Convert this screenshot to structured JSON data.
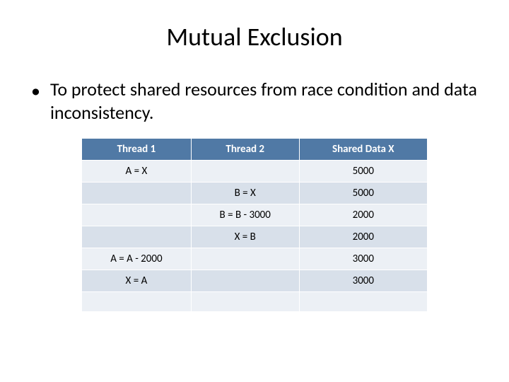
{
  "title": "Mutual Exclusion",
  "bullet_text": "To protect shared resources from race condition and data inconsistency.",
  "headers": {
    "c0": "Thread 1",
    "c1": "Thread 2",
    "c2": "Shared Data X"
  },
  "rows": [
    {
      "c0": "A = X",
      "c1": "",
      "c2": "5000"
    },
    {
      "c0": "",
      "c1": "B = X",
      "c2": "5000"
    },
    {
      "c0": "",
      "c1": "B = B - 3000",
      "c2": "2000"
    },
    {
      "c0": "",
      "c1": "X = B",
      "c2": "2000"
    },
    {
      "c0": "A = A - 2000",
      "c1": "",
      "c2": "3000"
    },
    {
      "c0": "X = A",
      "c1": "",
      "c2": "3000"
    },
    {
      "c0": "",
      "c1": "",
      "c2": ""
    }
  ],
  "chart_data": {
    "type": "table",
    "columns": [
      "Thread 1",
      "Thread 2",
      "Shared Data X"
    ],
    "rows": [
      [
        "A = X",
        "",
        5000
      ],
      [
        "",
        "B = X",
        5000
      ],
      [
        "",
        "B = B - 3000",
        2000
      ],
      [
        "",
        "X = B",
        2000
      ],
      [
        "A = A - 2000",
        "",
        3000
      ],
      [
        "X = A",
        "",
        3000
      ],
      [
        "",
        "",
        ""
      ]
    ]
  }
}
